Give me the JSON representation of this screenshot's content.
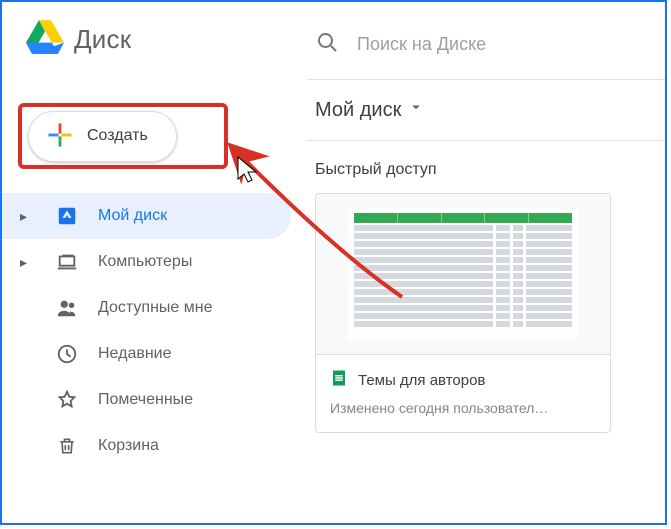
{
  "brand": {
    "title": "Диск"
  },
  "create": {
    "label": "Создать"
  },
  "sidebar": {
    "items": [
      {
        "label": "Мой диск"
      },
      {
        "label": "Компьютеры"
      },
      {
        "label": "Доступные мне"
      },
      {
        "label": "Недавние"
      },
      {
        "label": "Помеченные"
      },
      {
        "label": "Корзина"
      }
    ]
  },
  "search": {
    "placeholder": "Поиск на Диске"
  },
  "folder": {
    "current": "Мой диск"
  },
  "quick": {
    "heading": "Быстрый доступ",
    "card": {
      "title": "Темы для авторов",
      "subtitle": "Изменено сегодня пользовател…"
    }
  },
  "colors": {
    "accent": "#1a73e8",
    "highlight_box": "#d93025",
    "sheets_icon": "#0f9d58"
  }
}
